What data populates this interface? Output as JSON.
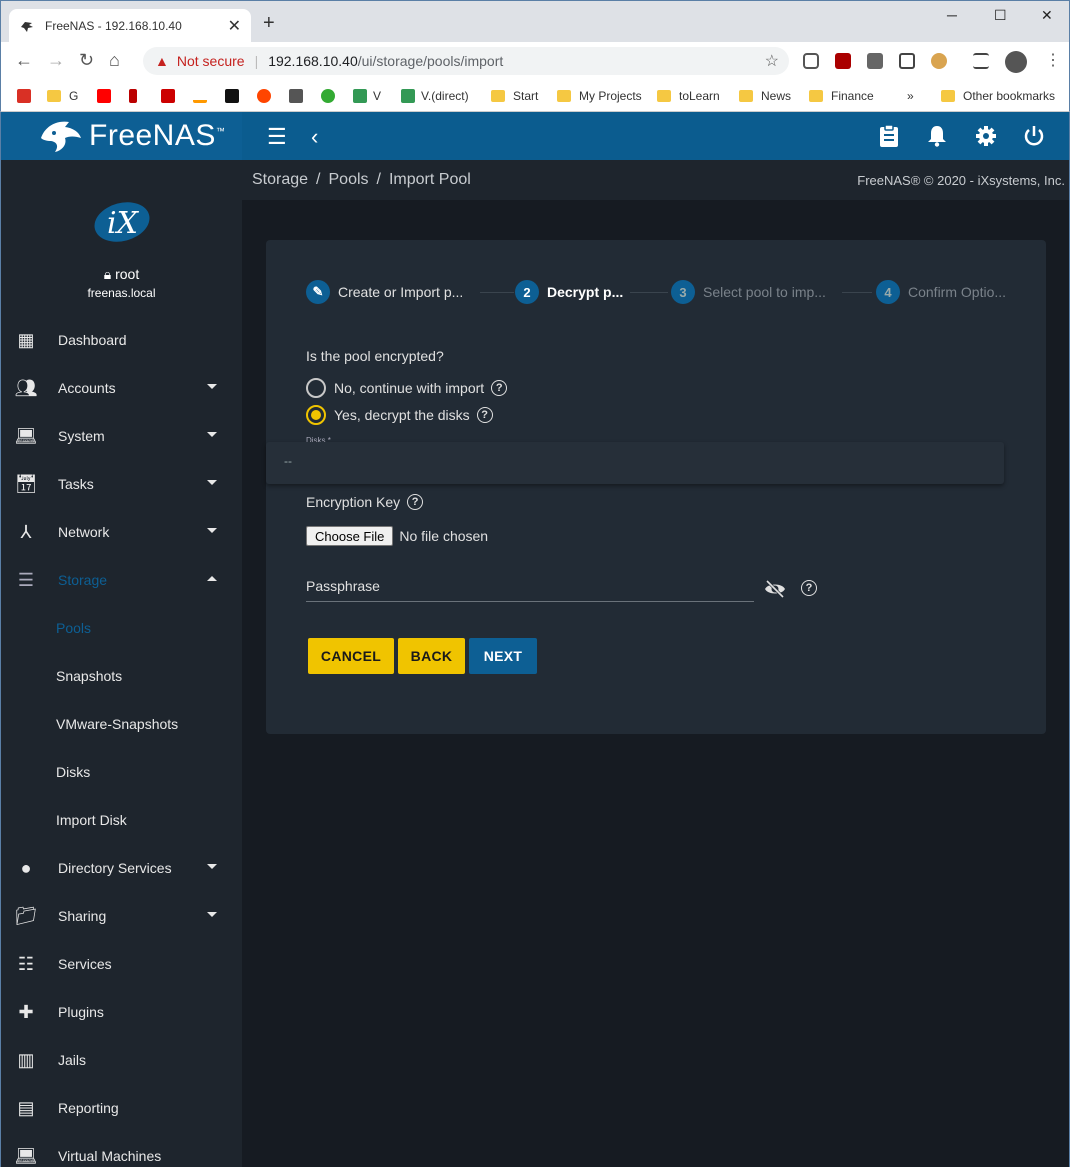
{
  "browser": {
    "tab_title": "FreeNAS - 192.168.10.40",
    "address": {
      "warning": "Not secure",
      "host": "192.168.10.40",
      "path": "/ui/storage/pools/import"
    },
    "bookmarks": [
      {
        "label": "G"
      },
      {
        "label": "V"
      },
      {
        "label": "V.(direct)"
      },
      {
        "label": "Start"
      },
      {
        "label": "My Projects"
      },
      {
        "label": "toLearn"
      },
      {
        "label": "News"
      },
      {
        "label": "Finance"
      },
      {
        "label": "Other bookmarks"
      }
    ],
    "more_bookmarks": "»"
  },
  "app": {
    "logo": "FreeNAS",
    "logo_tm": "™",
    "user": {
      "name": "root",
      "host": "freenas.local"
    },
    "nav": [
      {
        "label": "Dashboard",
        "icon": "dashboard-icon"
      },
      {
        "label": "Accounts",
        "icon": "people-icon"
      },
      {
        "label": "System",
        "icon": "laptop-icon"
      },
      {
        "label": "Tasks",
        "icon": "calendar-icon"
      },
      {
        "label": "Network",
        "icon": "network-icon"
      },
      {
        "label": "Storage",
        "icon": "storage-icon"
      },
      {
        "label": "Directory Services",
        "icon": "directory-icon"
      },
      {
        "label": "Sharing",
        "icon": "folder-share-icon"
      },
      {
        "label": "Services",
        "icon": "tune-icon"
      },
      {
        "label": "Plugins",
        "icon": "puzzle-icon"
      },
      {
        "label": "Jails",
        "icon": "jail-icon"
      },
      {
        "label": "Reporting",
        "icon": "chart-icon"
      },
      {
        "label": "Virtual Machines",
        "icon": "computer-icon"
      }
    ],
    "storage_sub": [
      {
        "label": "Pools"
      },
      {
        "label": "Snapshots"
      },
      {
        "label": "VMware-Snapshots"
      },
      {
        "label": "Disks"
      },
      {
        "label": "Import Disk"
      }
    ],
    "breadcrumb": [
      "Storage",
      "Pools",
      "Import Pool"
    ],
    "copyright": "FreeNAS® © 2020 - iXsystems, Inc."
  },
  "wizard": {
    "steps": [
      {
        "num": "",
        "label": "Create or Import p..."
      },
      {
        "num": "2",
        "label": "Decrypt p..."
      },
      {
        "num": "3",
        "label": "Select pool to imp..."
      },
      {
        "num": "4",
        "label": "Confirm Optio..."
      }
    ],
    "question": "Is the pool encrypted?",
    "option_no": "No, continue with import",
    "option_yes": "Yes, decrypt the disks",
    "disks_label": "Disks *",
    "disks_value": "--",
    "encryption_key_label": "Encryption Key",
    "choose_file": "Choose File",
    "no_file": "No file chosen",
    "passphrase_placeholder": "Passphrase",
    "cancel": "CANCEL",
    "back": "BACK",
    "next": "NEXT"
  }
}
